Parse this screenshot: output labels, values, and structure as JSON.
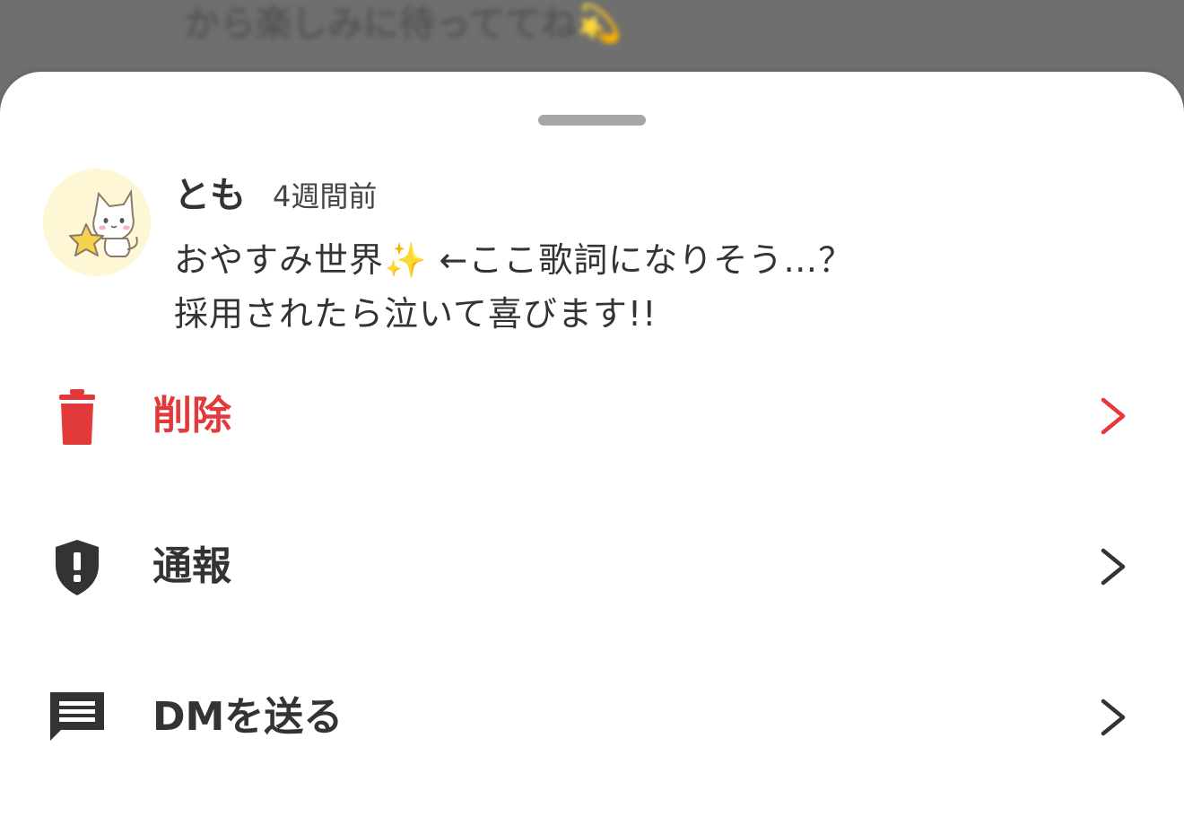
{
  "background": {
    "text": "から楽しみに待っててね💫"
  },
  "comment": {
    "user_name": "とも",
    "timestamp": "4週間前",
    "lines": [
      "おやすみ世界✨ ←ここ歌詞になりそう…？",
      "採用されたら泣いて喜びます!!"
    ],
    "avatar_icon": "cat-holding-star-icon"
  },
  "actions": [
    {
      "label": "削除",
      "icon": "trash-icon",
      "color": "#e23a3a"
    },
    {
      "label": "通報",
      "icon": "shield-alert-icon",
      "color": "#333333"
    },
    {
      "label": "DMを送る",
      "icon": "message-icon",
      "color": "#333333"
    }
  ],
  "colors": {
    "danger": "#e23a3a",
    "text": "#333333",
    "overlay": "#6f6f6f",
    "avatar_bg": "#fdf7d6"
  }
}
